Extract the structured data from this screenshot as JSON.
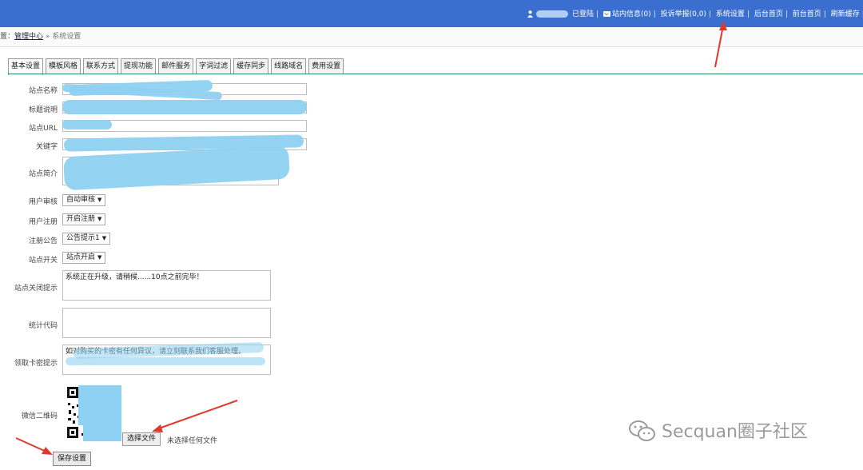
{
  "topbar": {
    "logged_in": "已登陆",
    "messages": "站内信息(0)",
    "reports": "投诉举报(0,0)",
    "system_settings": "系统设置",
    "admin_home": "后台首页",
    "front_home": "前台首页",
    "refresh_cache": "刷新缓存",
    "cut_off": "安"
  },
  "breadcrumb": {
    "prefix": "置：",
    "admin_center": "管理中心",
    "separator": "»",
    "current": "系统设置"
  },
  "tabs": [
    "基本设置",
    "模板风格",
    "联系方式",
    "提现功能",
    "邮件服务",
    "字词过滤",
    "缓存同步",
    "线路域名",
    "费用设置"
  ],
  "form": {
    "site_name_label": "站点名称",
    "title_desc_label": "标题说明",
    "site_url_label": "站点URL",
    "keywords_label": "关键字",
    "site_intro_label": "站点简介",
    "user_review_label": "用户审核",
    "user_review_value": "自动审核",
    "user_register_label": "用户注册",
    "user_register_value": "开启注册",
    "register_notice_label": "注册公告",
    "register_notice_value": "公告提示1",
    "site_switch_label": "站点开关",
    "site_switch_value": "站点开启",
    "close_notice_label": "站点关闭提示",
    "close_notice_value": "系统正在升级，请稍候......10点之前完毕！",
    "stats_code_label": "统计代码",
    "stats_code_value": "",
    "card_notice_label": "领取卡密提示",
    "card_notice_value": "如对购买的卡密有任何异议，请立刻联系我们客服处理。",
    "wechat_qr_label": "微信二维码",
    "choose_file": "选择文件",
    "no_file": "未选择任何文件",
    "save": "保存设置"
  },
  "watermark": "Secquan圈子社区",
  "colors": {
    "topbar_bg": "#3a6fd0",
    "redaction": "#8fd1f2",
    "annotation_arrow": "#e0392b",
    "tab_underline": "#2e8b57"
  }
}
